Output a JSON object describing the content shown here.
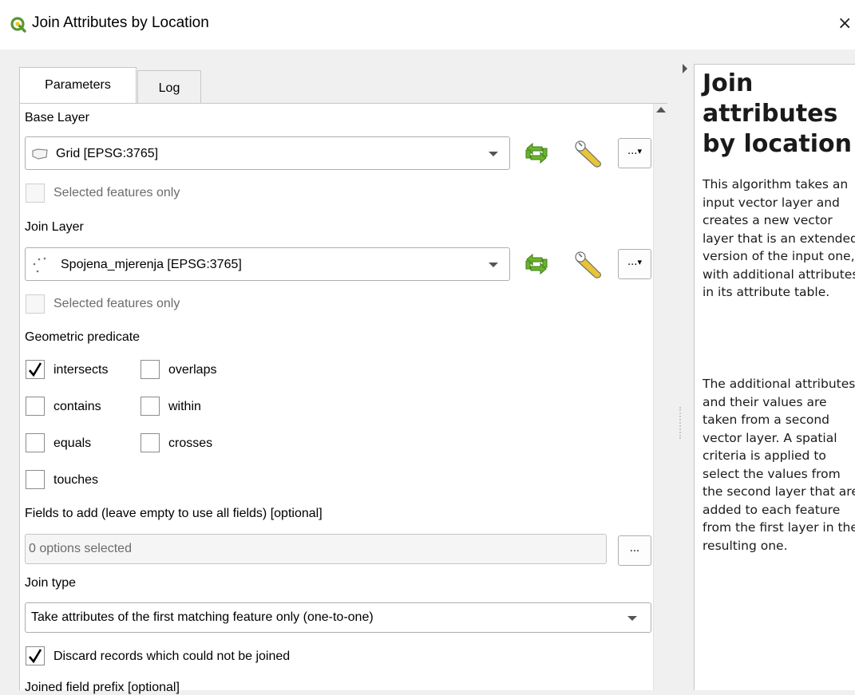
{
  "window": {
    "title": "Join Attributes by Location",
    "close_glyph": "×"
  },
  "tabs": [
    {
      "label": "Parameters",
      "active": true
    },
    {
      "label": "Log",
      "active": false
    }
  ],
  "base_layer": {
    "label": "Base Layer",
    "value": "Grid [EPSG:3765]",
    "icon": "polygon-layer-icon",
    "selected_only_label": "Selected features only",
    "selected_only_checked": false
  },
  "join_layer": {
    "label": "Join Layer",
    "value": "Spojena_mjerenja [EPSG:3765]",
    "icon": "point-layer-icon",
    "selected_only_label": "Selected features only",
    "selected_only_checked": false
  },
  "geometric_predicate": {
    "label": "Geometric predicate",
    "options": [
      {
        "label": "intersects",
        "checked": true
      },
      {
        "label": "overlaps",
        "checked": false
      },
      {
        "label": "contains",
        "checked": false
      },
      {
        "label": "within",
        "checked": false
      },
      {
        "label": "equals",
        "checked": false
      },
      {
        "label": "crosses",
        "checked": false
      },
      {
        "label": "touches",
        "checked": false
      }
    ]
  },
  "fields_to_add": {
    "label": "Fields to add (leave empty to use all fields) [optional]",
    "value": "0 options selected",
    "button": "..."
  },
  "join_type": {
    "label": "Join type",
    "value": "Take attributes of the first matching feature only (one-to-one)"
  },
  "discard": {
    "label": "Discard records which could not be joined",
    "checked": true
  },
  "prefix": {
    "label": "Joined field prefix [optional]"
  },
  "side_buttons": {
    "dots": "...",
    "dots_arrow": "▾"
  },
  "help": {
    "title": "Join attributes by location",
    "para1": "This algorithm takes an input vector layer and creates a new vector layer that is an extended version of the input one, with additional attributes in its attribute table.",
    "para2": "The additional attributes and their values are taken from a second vector layer. A spatial criteria is applied to select the values from the second layer that are added to each feature from the first layer in the resulting one."
  },
  "colors": {
    "qgis_green": "#589632",
    "qgis_yellow": "#ee7913",
    "iterate_green": "#6ab42d"
  }
}
